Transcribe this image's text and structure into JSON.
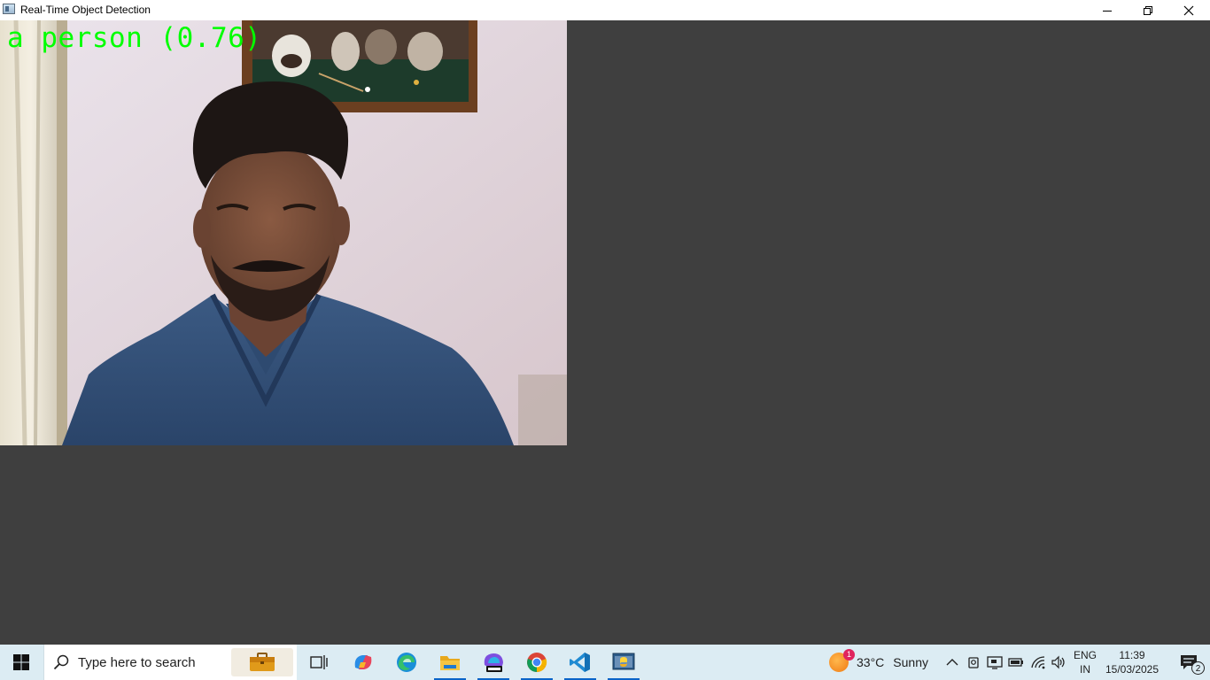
{
  "window": {
    "title": "Real-Time Object Detection"
  },
  "video": {
    "detection_label": "a person (0.76)",
    "label_color": "#00ff00"
  },
  "taskbar": {
    "search_placeholder": "Type here to search",
    "pinned_apps": [
      "task-view",
      "copilot",
      "edge",
      "file-explorer",
      "microsoft-365",
      "chrome",
      "vscode",
      "python"
    ],
    "weather": {
      "temperature": "33°C",
      "condition": "Sunny",
      "badge": "1"
    },
    "language": {
      "line1": "ENG",
      "line2": "IN"
    },
    "clock": {
      "time": "11:39",
      "date": "15/03/2025"
    },
    "notifications_count": "2"
  },
  "colors": {
    "client_bg": "#3f3f3f",
    "taskbar_bg": "#dcecf3",
    "accent": "#0a64c8"
  }
}
